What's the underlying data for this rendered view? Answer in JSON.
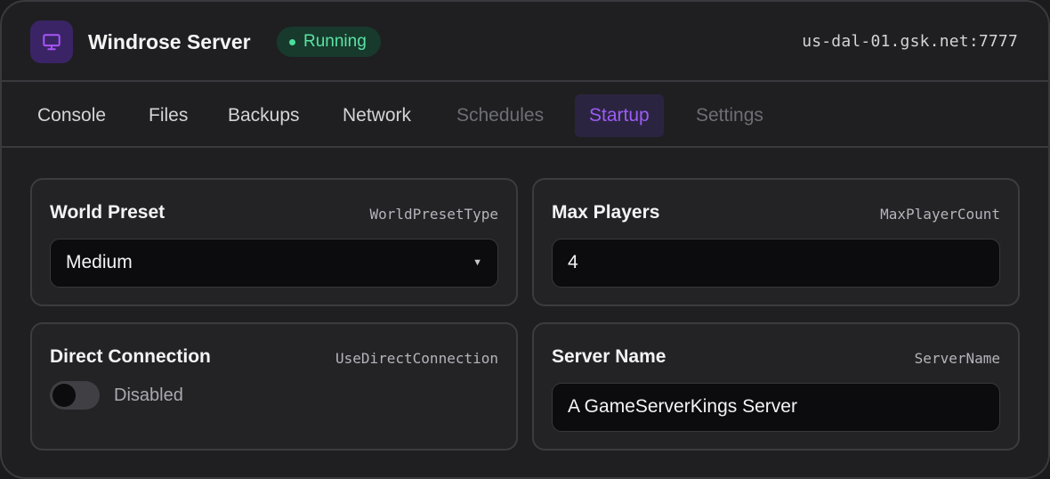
{
  "header": {
    "icon": "monitor-icon",
    "title": "Windrose Server",
    "status": "Running",
    "status_color": "#5ce3a3",
    "address": "us-dal-01.gsk.net:7777"
  },
  "tabs": [
    {
      "label": "Console",
      "state": "normal"
    },
    {
      "label": "Files",
      "state": "normal"
    },
    {
      "label": "Backups",
      "state": "normal"
    },
    {
      "label": "Network",
      "state": "normal"
    },
    {
      "label": "Schedules",
      "state": "muted"
    },
    {
      "label": "Startup",
      "state": "active"
    },
    {
      "label": "Settings",
      "state": "muted"
    }
  ],
  "accent_color": "#9b5cf6",
  "settings": {
    "world_preset": {
      "title": "World Preset",
      "key": "WorldPresetType",
      "value": "Medium"
    },
    "max_players": {
      "title": "Max Players",
      "key": "MaxPlayerCount",
      "value": "4"
    },
    "direct_connection": {
      "title": "Direct Connection",
      "key": "UseDirectConnection",
      "enabled": false,
      "state_label": "Disabled"
    },
    "server_name": {
      "title": "Server Name",
      "key": "ServerName",
      "value": "A GameServerKings Server"
    }
  }
}
